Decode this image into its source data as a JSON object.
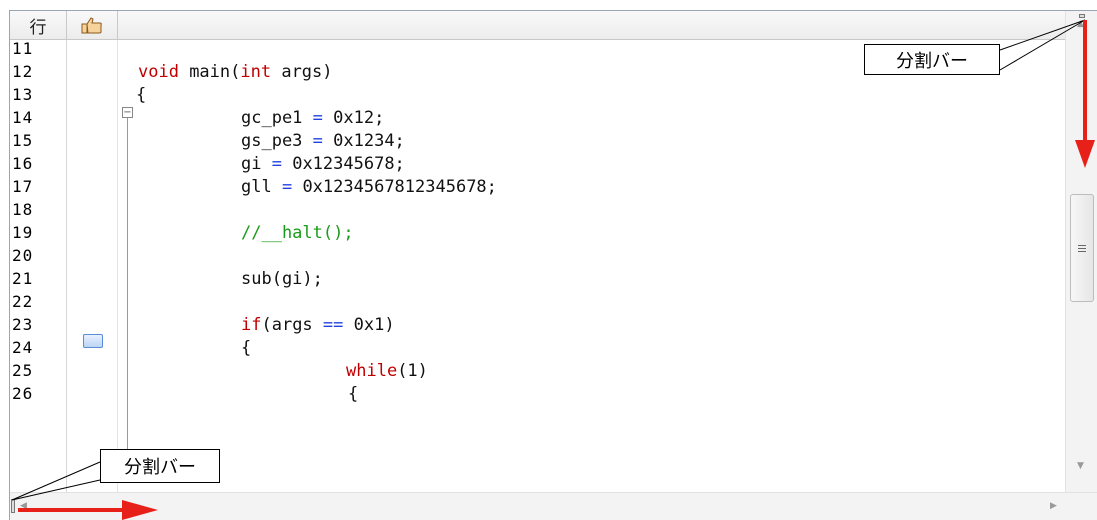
{
  "header": {
    "line_label": "行",
    "mark_icon": "pointing-hand-icon"
  },
  "line_numbers": [
    "11",
    "12",
    "13",
    "14",
    "15",
    "16",
    "17",
    "18",
    "19",
    "20",
    "21",
    "22",
    "23",
    "24",
    "25",
    "26"
  ],
  "code": {
    "l12_kw": "void",
    "l12_rest1": " main(",
    "l12_ty": "int",
    "l12_rest2": " args)",
    "l13": "{",
    "l14_a": "gc_pe1 ",
    "l14_op": "=",
    "l14_b": " 0x12;",
    "l15_a": "gs_pe3 ",
    "l15_op": "=",
    "l15_b": " 0x1234;",
    "l16_a": "gi ",
    "l16_op": "=",
    "l16_b": " 0x12345678;",
    "l17_a": "gll ",
    "l17_op": "=",
    "l17_b": " 0x1234567812345678;",
    "l19": "//__halt();",
    "l21": "sub(gi);",
    "l23_kw": "if",
    "l23_a": "(args ",
    "l23_op": "==",
    "l23_b": " 0x1)",
    "l24": "{",
    "l25_kw": "while",
    "l25_rest": "(1)",
    "l26": "{"
  },
  "callouts": {
    "top": "分割バー",
    "bottom": "分割バー"
  },
  "colors": {
    "annotation_arrow": "#e8201a",
    "keyword": "#c00000",
    "operator": "#2040e0",
    "comment": "#1a9b1a"
  }
}
